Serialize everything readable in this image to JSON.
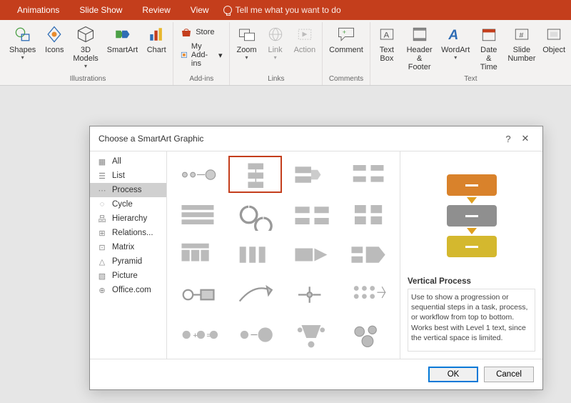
{
  "ribbonTabs": [
    "Animations",
    "Slide Show",
    "Review",
    "View"
  ],
  "tellMe": "Tell me what you want to do",
  "groups": {
    "illustrations": {
      "label": "Illustrations",
      "items": {
        "shapes": "Shapes",
        "icons": "Icons",
        "models": "3D\nModels",
        "smartart": "SmartArt",
        "chart": "Chart"
      }
    },
    "addins": {
      "label": "Add-ins",
      "store": "Store",
      "myaddins": "My Add-ins"
    },
    "links": {
      "label": "Links",
      "zoom": "Zoom",
      "link": "Link",
      "action": "Action"
    },
    "comments": {
      "label": "Comments",
      "comment": "Comment"
    },
    "text": {
      "label": "Text",
      "textbox": "Text\nBox",
      "header": "Header\n& Footer",
      "wordart": "WordArt",
      "datetime": "Date &\nTime",
      "slidenum": "Slide\nNumber",
      "object": "Object"
    }
  },
  "dialog": {
    "title": "Choose a SmartArt Graphic",
    "categories": [
      "All",
      "List",
      "Process",
      "Cycle",
      "Hierarchy",
      "Relations...",
      "Matrix",
      "Pyramid",
      "Picture",
      "Office.com"
    ],
    "selectedCategory": "Process",
    "preview": {
      "title": "Vertical Process",
      "desc": "Use to show a progression or sequential steps in a task, process, or workflow from top to bottom. Works best with Level 1 text, since the vertical space is limited.",
      "colors": [
        "#d9822b",
        "#8f8f8f",
        "#d4b82e"
      ],
      "arrowColor": "#e0a020"
    },
    "ok": "OK",
    "cancel": "Cancel"
  }
}
